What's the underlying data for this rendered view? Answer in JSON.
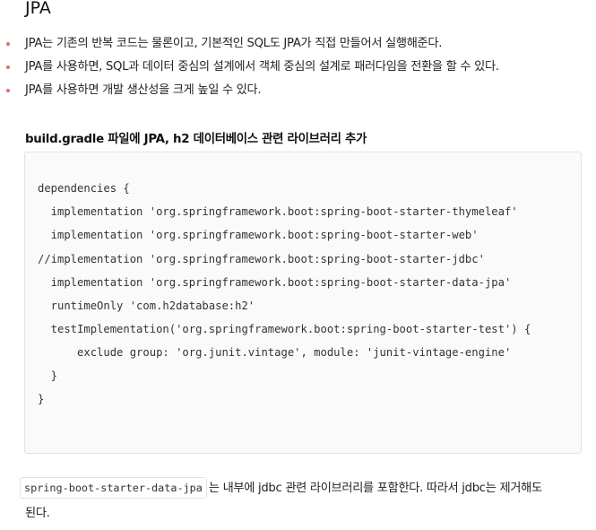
{
  "heading": "JPA",
  "bullets": [
    "JPA는 기존의 반복 코드는 물론이고, 기본적인 SQL도 JPA가 직접 만들어서 실행해준다.",
    "JPA를 사용하면, SQL과 데이터 중심의 설계에서 객체 중심의 설계로 패러다임을 전환을 할 수 있다.",
    "JPA를 사용하면 개발 생산성을 크게 높일 수 있다."
  ],
  "subheading": "build.gradle 파일에 JPA, h2 데이터베이스 관련 라이브러리 추가",
  "code_lines": [
    "dependencies {",
    "  implementation 'org.springframework.boot:spring-boot-starter-thymeleaf'",
    "  implementation 'org.springframework.boot:spring-boot-starter-web'",
    "//implementation 'org.springframework.boot:spring-boot-starter-jdbc'",
    "  implementation 'org.springframework.boot:spring-boot-starter-data-jpa'",
    "  runtimeOnly 'com.h2database:h2'",
    "  testImplementation('org.springframework.boot:spring-boot-starter-test') {",
    "      exclude group: 'org.junit.vintage', module: 'junit-vintage-engine'",
    "  }",
    "}"
  ],
  "footer": {
    "inline_code": "spring-boot-starter-data-jpa",
    "text_line1": "는 내부에 jdbc 관련 라이브러리를 포함한다. 따라서 jdbc는 제거해도",
    "text_line2": "된다."
  }
}
